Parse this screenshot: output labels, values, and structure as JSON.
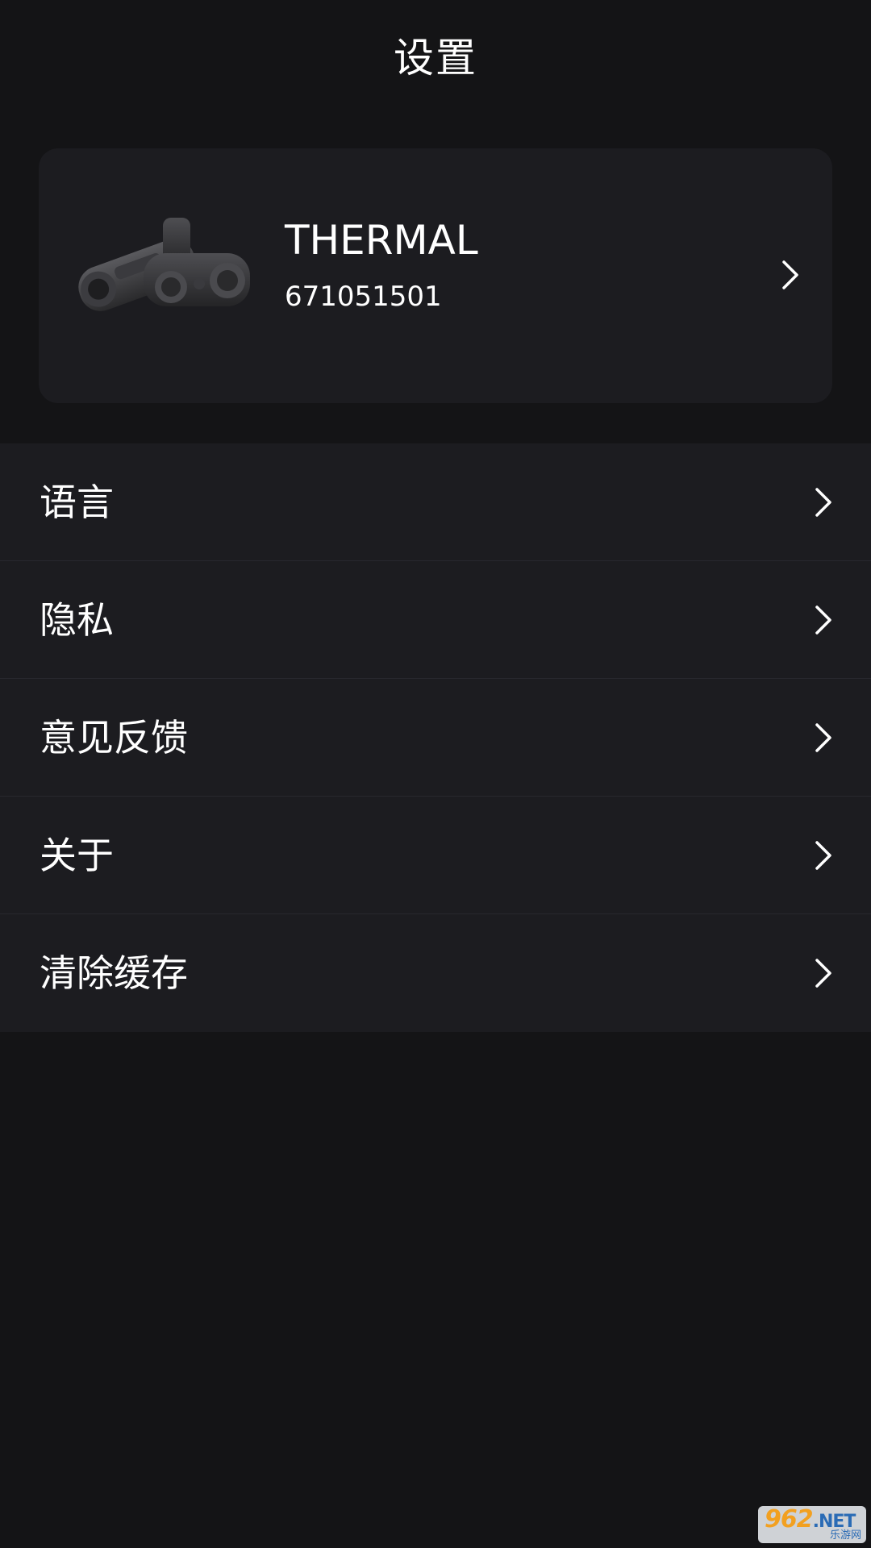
{
  "header": {
    "title": "设置"
  },
  "device": {
    "name": "THERMAL",
    "id": "671051501",
    "image_icon": "thermal-monocular-binocular-image",
    "chevron_icon": "chevron-right-icon"
  },
  "settings": {
    "items": [
      {
        "label": "语言",
        "icon": "chevron-right-icon"
      },
      {
        "label": "隐私",
        "icon": "chevron-right-icon"
      },
      {
        "label": "意见反馈",
        "icon": "chevron-right-icon"
      },
      {
        "label": "关于",
        "icon": "chevron-right-icon"
      },
      {
        "label": "清除缓存",
        "icon": "chevron-right-icon"
      }
    ]
  },
  "watermark": {
    "brand": "962",
    "suffix": ".NET",
    "subtitle": "乐游网"
  },
  "colors": {
    "background": "#141416",
    "card": "#1c1c20",
    "divider": "#28282e",
    "text": "#ffffff"
  }
}
